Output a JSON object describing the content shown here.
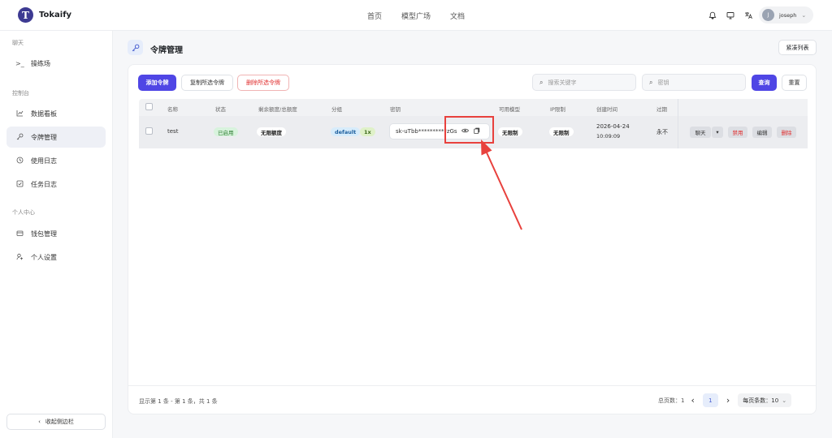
{
  "app": {
    "name": "Tokaify",
    "logo_letter": "T"
  },
  "topnav": [
    "首页",
    "模型广场",
    "文档"
  ],
  "top_icons": [
    "bell-icon",
    "monitor-icon",
    "translate-icon"
  ],
  "user": {
    "name": "joseph",
    "initial": "J"
  },
  "sidebar": {
    "sections": [
      {
        "label": "聊天",
        "items": [
          {
            "label": "操练场",
            "icon": "terminal-icon"
          }
        ]
      },
      {
        "label": "控制台",
        "items": [
          {
            "label": "数据看板",
            "icon": "chart-icon"
          },
          {
            "label": "令牌管理",
            "icon": "key-icon",
            "active": true
          },
          {
            "label": "使用日志",
            "icon": "history-icon"
          },
          {
            "label": "任务日志",
            "icon": "task-icon"
          }
        ]
      },
      {
        "label": "个人中心",
        "items": [
          {
            "label": "钱包管理",
            "icon": "wallet-icon"
          },
          {
            "label": "个人设置",
            "icon": "user-settings-icon"
          }
        ]
      }
    ],
    "collapse_label": "收起侧边栏"
  },
  "page": {
    "title": "令牌管理",
    "compact_label": "紧凑列表"
  },
  "toolbar": {
    "add": "添加令牌",
    "copy_selected": "复制所选令牌",
    "delete_selected": "删除所选令牌",
    "search_keyword_placeholder": "搜索关键字",
    "search_key_placeholder": "密钥",
    "query": "查询",
    "reset": "重置"
  },
  "table": {
    "headers": [
      "名称",
      "状态",
      "剩余额度/总额度",
      "分组",
      "密钥",
      "可用模型",
      "IP限制",
      "创建时间",
      "过期"
    ],
    "rows": [
      {
        "name": "test",
        "status": "已启用",
        "quota": "无限额度",
        "group": "default",
        "ratio": "1x",
        "key": "sk-uTbb**********zGs",
        "models": "无限制",
        "ip": "无限制",
        "created_date": "2026-04-24",
        "created_time": "10:09:09",
        "expire": "永不",
        "actions": {
          "chat": "聊天",
          "disable": "禁用",
          "edit": "编辑",
          "delete": "删除"
        }
      }
    ]
  },
  "footer": {
    "summary": "显示第 1 条 - 第 1 条，共 1 条",
    "total_pages": "总页数：1",
    "current_page": "1",
    "page_size": "每页条数：10"
  },
  "colors": {
    "primary": "#4f46e5",
    "danger": "#e02c2c",
    "annotation": "#e8413d"
  }
}
